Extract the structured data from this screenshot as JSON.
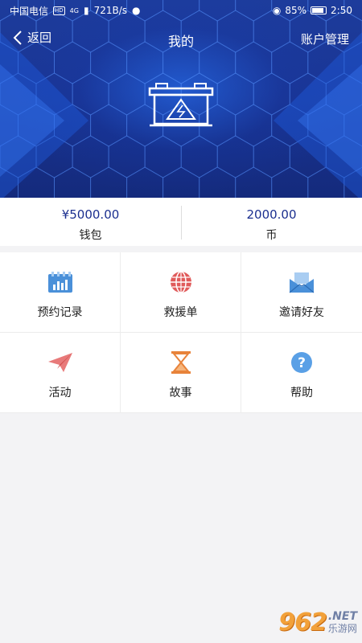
{
  "status_bar": {
    "carrier": "中国电信",
    "hd": "HD",
    "net": "4G",
    "speed": "721B/s",
    "battery": "85%",
    "time": "2:50"
  },
  "nav": {
    "back_label": "返回",
    "title": "我的",
    "right_label": "账户管理"
  },
  "wallet": {
    "balance": "¥5000.00",
    "balance_label": "钱包",
    "coins": "2000.00",
    "coins_label": "币"
  },
  "menu": [
    {
      "label": "预约记录",
      "icon": "calendar-icon"
    },
    {
      "label": "救援单",
      "icon": "globe-icon"
    },
    {
      "label": "邀请好友",
      "icon": "envelope-icon"
    },
    {
      "label": "活动",
      "icon": "paper-plane-icon"
    },
    {
      "label": "故事",
      "icon": "hourglass-icon"
    },
    {
      "label": "帮助",
      "icon": "help-icon"
    }
  ],
  "colors": {
    "header_blue": "#1a3492",
    "accent_blue": "#1b2f8f",
    "orange": "#e8833a",
    "red": "#e05a5a",
    "light_blue": "#4a90d9"
  },
  "watermark": {
    "number": "962",
    "net": ".NET",
    "cn": "乐游网"
  }
}
